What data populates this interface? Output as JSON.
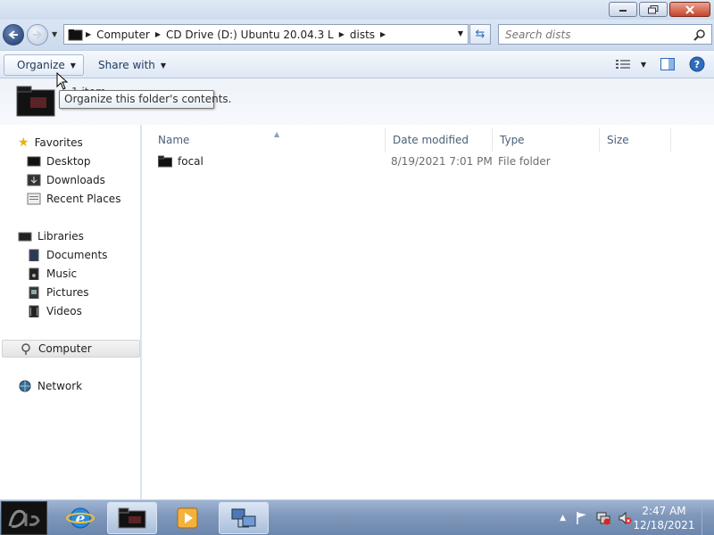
{
  "window": {
    "controls": {
      "minimize": "minimize-icon",
      "maximize": "restore-icon",
      "close": "close-icon"
    }
  },
  "address_bar": {
    "crumbs": [
      "Computer",
      "CD Drive (D:) Ubuntu 20.04.3 L",
      "dists"
    ]
  },
  "search": {
    "placeholder": "Search dists"
  },
  "toolbar": {
    "organize_label": "Organize",
    "share_label": "Share with"
  },
  "details": {
    "item_count": "1 item"
  },
  "tooltip": {
    "text": "Organize this folder's contents."
  },
  "nav": {
    "favorites": {
      "label": "Favorites",
      "items": [
        "Desktop",
        "Downloads",
        "Recent Places"
      ]
    },
    "libraries": {
      "label": "Libraries",
      "items": [
        "Documents",
        "Music",
        "Pictures",
        "Videos"
      ]
    },
    "computer": {
      "label": "Computer"
    },
    "network": {
      "label": "Network"
    }
  },
  "columns": [
    "Name",
    "Date modified",
    "Type",
    "Size"
  ],
  "files": [
    {
      "name": "focal",
      "date_modified": "8/19/2021 7:01 PM",
      "type": "File folder",
      "size": ""
    }
  ],
  "taskbar": {
    "time": "2:47 AM",
    "date": "12/18/2021"
  },
  "colors": {
    "accent": "#2f6dbb",
    "selection": "#e4e4e4",
    "taskbar": "#7f97ba"
  }
}
